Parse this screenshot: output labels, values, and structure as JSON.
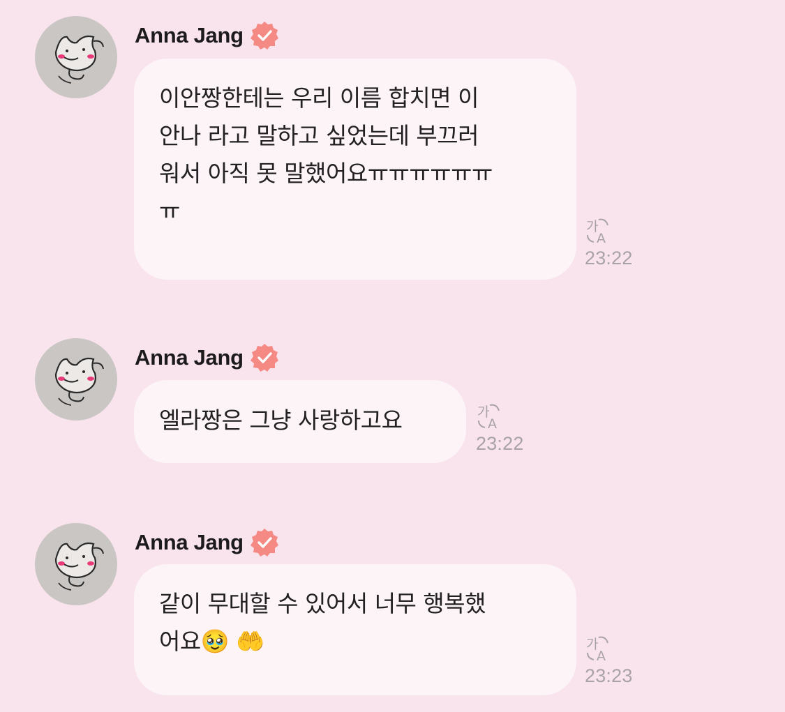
{
  "messages": [
    {
      "sender": "Anna Jang",
      "text": "이안짱한테는 우리 이름 합치면 이\n안나 라고 말하고 싶었는데 부끄러\n워서 아직 못 말했어요ㅠㅠㅠㅠㅠㅠ\nㅠ",
      "time": "23:22",
      "translate_icon": "translate-icon"
    },
    {
      "sender": "Anna Jang",
      "text": "엘라짱은 그냥 사랑하고요",
      "time": "23:22",
      "translate_icon": "translate-icon"
    },
    {
      "sender": "Anna Jang",
      "text": "같이 무대할 수 있어서 너무 행복했\n어요🥹 🤲",
      "time": "23:23",
      "translate_icon": "translate-icon"
    }
  ],
  "colors": {
    "background": "#f9e4ee",
    "bubble": "#fcf4f7",
    "verified_badge": "#f58a85",
    "timestamp": "#a9a2a6"
  }
}
